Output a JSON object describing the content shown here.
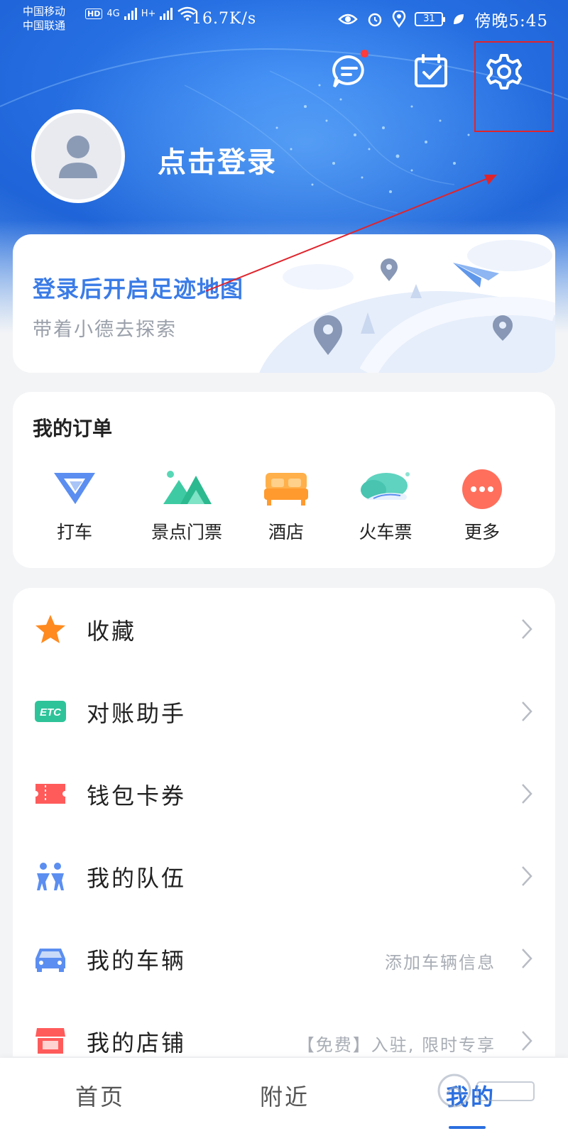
{
  "status_bar": {
    "carrier_1": "中国移动",
    "carrier_2": "中国联通",
    "hd_badge": "HD",
    "net_1": "4G",
    "net_2": "H+",
    "net_speed": "16.7K/s",
    "battery": "31",
    "time": "傍晚5:45"
  },
  "header": {
    "login_text": "点击登录",
    "icons": [
      "message-icon",
      "task-check-icon",
      "gear-icon",
      "avatar-icon"
    ],
    "has_unread_message": true
  },
  "footprint_card": {
    "title": "登录后开启足迹地图",
    "subtitle": "带着小德去探索"
  },
  "orders": {
    "title": "我的订单",
    "items": [
      {
        "label": "打车",
        "icon": "taxi-icon"
      },
      {
        "label": "景点门票",
        "icon": "scenic-ticket-icon"
      },
      {
        "label": "酒店",
        "icon": "hotel-bed-icon"
      },
      {
        "label": "火车票",
        "icon": "train-ticket-icon"
      },
      {
        "label": "更多",
        "icon": "more-dots-icon"
      }
    ]
  },
  "menu": {
    "items": [
      {
        "label": "收藏",
        "icon": "star-icon",
        "extra": ""
      },
      {
        "label": "对账助手",
        "icon": "etc-icon",
        "extra": ""
      },
      {
        "label": "钱包卡券",
        "icon": "ticket-icon",
        "extra": ""
      },
      {
        "label": "我的队伍",
        "icon": "team-icon",
        "extra": ""
      },
      {
        "label": "我的车辆",
        "icon": "car-icon",
        "extra": "添加车辆信息"
      },
      {
        "label": "我的店铺",
        "icon": "shop-icon",
        "extra": "【免费】入驻, 限时专享"
      }
    ]
  },
  "bottom_nav": {
    "home": "首页",
    "nearby": "附近",
    "me": "我的"
  },
  "colors": {
    "accent": "#2b6fe0",
    "header_blue": "#1f64d8",
    "annotation_red": "#e0242c"
  }
}
